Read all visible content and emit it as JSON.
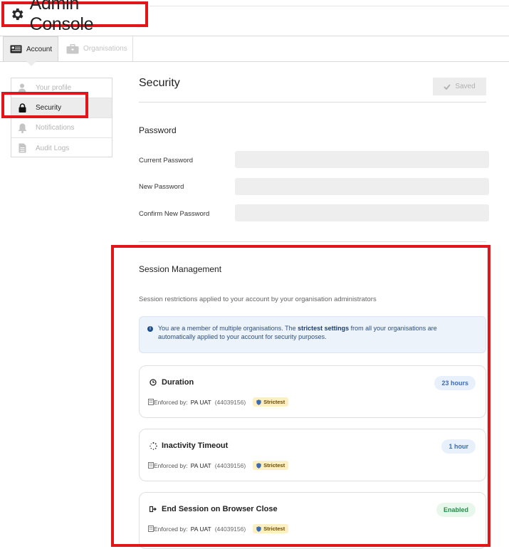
{
  "header": {
    "title": "Admin Console",
    "icon": "gear-icon"
  },
  "tabs": [
    {
      "label": "Account",
      "icon": "account-card-icon",
      "active": true
    },
    {
      "label": "Organisations",
      "icon": "briefcase-icon",
      "active": false
    }
  ],
  "sidebar": {
    "items": [
      {
        "label": "Your profile",
        "icon": "user-icon",
        "active": false
      },
      {
        "label": "Security",
        "icon": "lock-icon",
        "active": true
      },
      {
        "label": "Notifications",
        "icon": "bell-icon",
        "active": false
      },
      {
        "label": "Audit Logs",
        "icon": "document-icon",
        "active": false
      }
    ]
  },
  "main": {
    "heading": "Security",
    "saved_label": "Saved",
    "password": {
      "heading": "Password",
      "fields": [
        {
          "label": "Current Password",
          "value": ""
        },
        {
          "label": "New Password",
          "value": ""
        },
        {
          "label": "Confirm New Password",
          "value": ""
        }
      ]
    },
    "session": {
      "heading": "Session Management",
      "description": "Session restrictions applied to your account by your organisation administrators",
      "info": {
        "prefix": "You are a member of multiple organisations. The ",
        "bold": "strictest settings",
        "suffix": " from all your organisations are automatically applied to your account for security purposes."
      },
      "enforced_label": "Enforced by:",
      "cards": [
        {
          "title": "Duration",
          "icon": "clock-icon",
          "org": "PA UAT",
          "code": "(44039156)",
          "badge": "Strictest",
          "value": "23 hours",
          "value_color": "#3d6cb0"
        },
        {
          "title": "Inactivity Timeout",
          "icon": "spinner-icon",
          "org": "PA UAT",
          "code": "(44039156)",
          "badge": "Strictest",
          "value": "1 hour",
          "value_color": "#3d6cb0"
        },
        {
          "title": "End Session on Browser Close",
          "icon": "sign-out-icon",
          "org": "PA UAT",
          "code": "(44039156)",
          "badge": "Strictest",
          "value": "Enabled",
          "value_color": "#2d8a47"
        }
      ]
    }
  },
  "colors": {
    "highlight": "#e0161b",
    "info_bg": "#edf3fb",
    "badge_bg": "#fcefc2"
  }
}
